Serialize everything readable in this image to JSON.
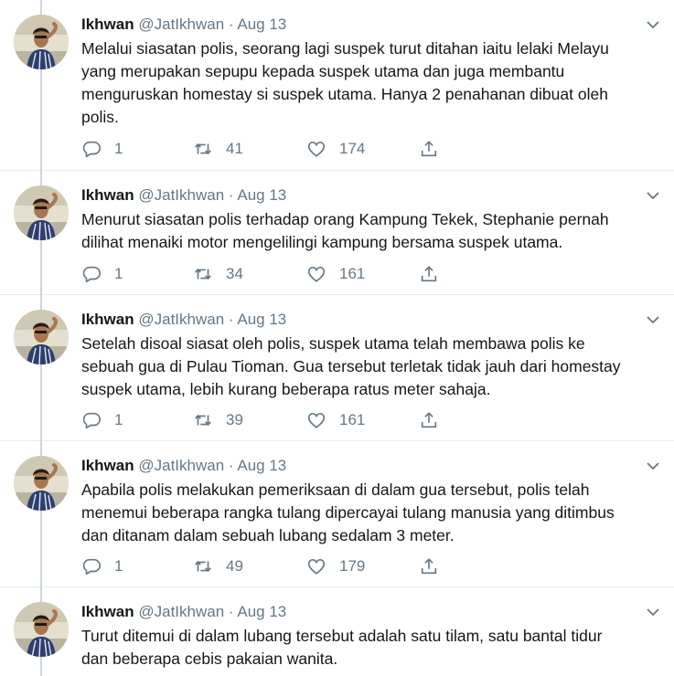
{
  "tweets": [
    {
      "name": "Ikhwan",
      "handle": "@JatIkhwan",
      "sep": "·",
      "date": "Aug 13",
      "text": "Melalui siasatan polis, seorang lagi suspek turut ditahan iaitu lelaki Melayu\nyang merupakan sepupu kepada suspek utama dan juga membantu\nmenguruskan homestay si suspek utama. Hanya 2  penahanan dibuat oleh\npolis.",
      "replies": "1",
      "retweets": "41",
      "likes": "174"
    },
    {
      "name": "Ikhwan",
      "handle": "@JatIkhwan",
      "sep": "·",
      "date": "Aug 13",
      "text": "Menurut siasatan polis terhadap orang Kampung Tekek, Stephanie pernah\ndilihat menaiki motor mengelilingi kampung bersama suspek utama.",
      "replies": "1",
      "retweets": "34",
      "likes": "161"
    },
    {
      "name": "Ikhwan",
      "handle": "@JatIkhwan",
      "sep": "·",
      "date": "Aug 13",
      "text": "Setelah disoal siasat oleh polis, suspek utama telah membawa polis ke\nsebuah gua di Pulau Tioman. Gua tersebut terletak tidak jauh dari homestay\nsuspek utama, lebih kurang beberapa ratus meter sahaja.",
      "replies": "1",
      "retweets": "39",
      "likes": "161"
    },
    {
      "name": "Ikhwan",
      "handle": "@JatIkhwan",
      "sep": "·",
      "date": "Aug 13",
      "text": "Apabila polis melakukan pemeriksaan di dalam gua tersebut, polis telah\nmenemui beberapa rangka tulang dipercayai tulang manusia yang ditimbus\ndan ditanam dalam sebuah lubang sedalam 3 meter.",
      "replies": "1",
      "retweets": "49",
      "likes": "179"
    },
    {
      "name": "Ikhwan",
      "handle": "@JatIkhwan",
      "sep": "·",
      "date": "Aug 13",
      "text": "Turut ditemui di dalam lubang tersebut adalah satu tilam, satu bantal tidur\ndan beberapa cebis pakaian wanita."
    }
  ],
  "icons": {
    "reply": "reply-icon",
    "retweet": "retweet-icon",
    "like": "heart-icon",
    "share": "share-icon",
    "menu": "chevron-down-icon"
  },
  "colors": {
    "icon_gray": "#657786",
    "thread_line": "#ccd6dd",
    "text": "#14171a",
    "divider": "#e6ecf0"
  }
}
